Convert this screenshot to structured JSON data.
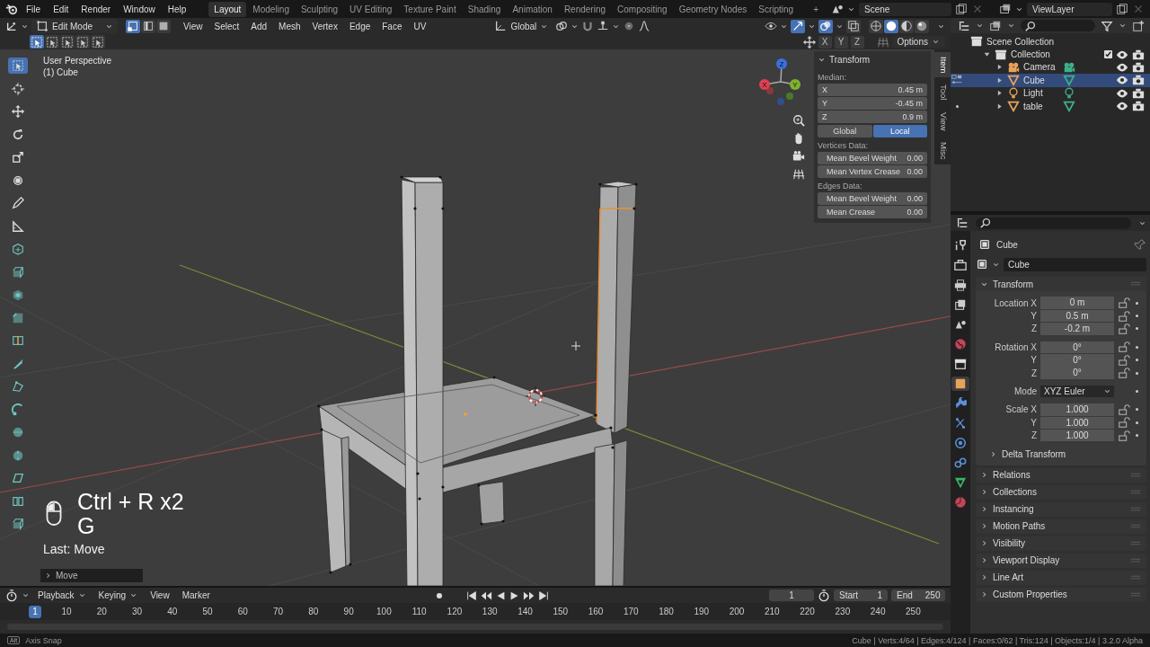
{
  "topbar": {
    "menus": [
      "File",
      "Edit",
      "Render",
      "Window",
      "Help"
    ],
    "workspaces": [
      {
        "label": "Layout",
        "selected": true
      },
      {
        "label": "Modeling",
        "selected": false
      },
      {
        "label": "Sculpting",
        "selected": false
      },
      {
        "label": "UV Editing",
        "selected": false
      },
      {
        "label": "Texture Paint",
        "selected": false
      },
      {
        "label": "Shading",
        "selected": false
      },
      {
        "label": "Animation",
        "selected": false
      },
      {
        "label": "Rendering",
        "selected": false
      },
      {
        "label": "Compositing",
        "selected": false
      },
      {
        "label": "Geometry Nodes",
        "selected": false
      },
      {
        "label": "Scripting",
        "selected": false
      }
    ],
    "add_tab": "+",
    "scene": "Scene",
    "view_layer": "ViewLayer"
  },
  "viewport_header": {
    "mode": "Edit Mode",
    "select_modes": [
      {
        "kind": "vertex",
        "selected": true
      },
      {
        "kind": "edge",
        "selected": false
      },
      {
        "kind": "face",
        "selected": false
      }
    ],
    "menus": [
      "View",
      "Select",
      "Add",
      "Mesh",
      "Vertex",
      "Edge",
      "Face",
      "UV"
    ],
    "orientation": "Global",
    "shading": [
      {
        "kind": "wireframe",
        "selected": false
      },
      {
        "kind": "solid",
        "selected": true
      },
      {
        "kind": "material",
        "selected": false
      },
      {
        "kind": "rendered",
        "selected": false
      }
    ],
    "mirror_axes": [
      "X",
      "Y",
      "Z"
    ],
    "options": "Options"
  },
  "viewport": {
    "view_name": "User Perspective",
    "object_label": "(1) Cube",
    "keystrokes": [
      "Ctrl + R x2",
      "G"
    ],
    "last_operation": "Last: Move",
    "operator_panel": "Move",
    "gizmo_axes": [
      "X",
      "Y",
      "Z"
    ],
    "tools": [
      {
        "kind": "select",
        "selected": true
      },
      {
        "kind": "cursor",
        "selected": false
      },
      {
        "kind": "move",
        "selected": false
      },
      {
        "kind": "rotate",
        "selected": false
      },
      {
        "kind": "scale",
        "selected": false
      },
      {
        "kind": "transform",
        "selected": false
      },
      {
        "kind": "annotate",
        "selected": false
      },
      {
        "kind": "measure",
        "selected": false
      },
      {
        "kind": "add",
        "selected": false
      },
      {
        "kind": "extrude",
        "selected": false
      },
      {
        "kind": "inset",
        "selected": false
      },
      {
        "kind": "bevel",
        "selected": false
      },
      {
        "kind": "loopcut",
        "selected": false
      },
      {
        "kind": "knife",
        "selected": false
      },
      {
        "kind": "polybuild",
        "selected": false
      },
      {
        "kind": "spin",
        "selected": false
      },
      {
        "kind": "smooth",
        "selected": false
      },
      {
        "kind": "shrink",
        "selected": false
      },
      {
        "kind": "shear",
        "selected": false
      },
      {
        "kind": "rip",
        "selected": false
      },
      {
        "kind": "extrude",
        "selected": false
      }
    ]
  },
  "sidebar": {
    "tabs": [
      {
        "label": "Item",
        "selected": true
      },
      {
        "label": "Tool",
        "selected": false
      },
      {
        "label": "View",
        "selected": false
      },
      {
        "label": "Misc",
        "selected": false
      }
    ],
    "panel_title": "Transform",
    "median_label": "Median:",
    "median": [
      {
        "axis": "X",
        "value": "0.45 m"
      },
      {
        "axis": "Y",
        "value": "-0.45 m"
      },
      {
        "axis": "Z",
        "value": "0.9 m"
      }
    ],
    "spaces": [
      {
        "label": "Global",
        "selected": false
      },
      {
        "label": "Local",
        "selected": true
      }
    ],
    "groups": [
      {
        "title": "Vertices Data:",
        "fields": [
          {
            "label": "Mean Bevel Weight",
            "value": "0.00"
          },
          {
            "label": "Mean Vertex Crease",
            "value": "0.00"
          }
        ]
      },
      {
        "title": "Edges Data:",
        "fields": [
          {
            "label": "Mean Bevel Weight",
            "value": "0.00"
          },
          {
            "label": "Mean Crease",
            "value": "0.00"
          }
        ]
      }
    ]
  },
  "outliner": {
    "tree": [
      {
        "name": "Scene Collection",
        "kind": "scene",
        "selected": false,
        "children": [
          {
            "name": "Collection",
            "kind": "collection",
            "selected": false,
            "expanded": true,
            "checked": true,
            "children": [
              {
                "name": "Camera",
                "kind": "camera",
                "selected": false,
                "expanded": false
              },
              {
                "name": "Cube",
                "kind": "mesh",
                "selected": true,
                "expanded": false,
                "edit_mode": true
              },
              {
                "name": "Light",
                "kind": "light",
                "selected": false,
                "expanded": false
              },
              {
                "name": "table",
                "kind": "mesh",
                "selected": false,
                "expanded": false,
                "edit_mode": false
              }
            ]
          }
        ]
      }
    ]
  },
  "properties": {
    "tabs": [
      {
        "kind": "tool",
        "selected": false
      },
      {
        "kind": "render",
        "selected": false
      },
      {
        "kind": "output",
        "selected": false
      },
      {
        "kind": "view_layer",
        "selected": false
      },
      {
        "kind": "scene",
        "selected": false
      },
      {
        "kind": "world",
        "selected": false
      },
      {
        "kind": "collection",
        "selected": false
      },
      {
        "kind": "object",
        "selected": true
      },
      {
        "kind": "modifiers",
        "selected": false
      },
      {
        "kind": "particles",
        "selected": false
      },
      {
        "kind": "physics",
        "selected": false
      },
      {
        "kind": "constraints",
        "selected": false
      },
      {
        "kind": "data",
        "selected": false
      },
      {
        "kind": "material",
        "selected": false
      }
    ],
    "context_name": "Cube",
    "object_name": "Cube",
    "transform": {
      "title": "Transform",
      "expanded": true,
      "groups": [
        {
          "rows": [
            {
              "label": "Location X",
              "value": "0 m",
              "kind": "number"
            },
            {
              "label": "Y",
              "value": "0.5 m",
              "kind": "number"
            },
            {
              "label": "Z",
              "value": "-0.2 m",
              "kind": "number"
            }
          ]
        },
        {
          "rows": [
            {
              "label": "Rotation X",
              "value": "0°",
              "kind": "number"
            },
            {
              "label": "Y",
              "value": "0°",
              "kind": "number"
            },
            {
              "label": "Z",
              "value": "0°",
              "kind": "number"
            }
          ]
        },
        {
          "rows": [
            {
              "label": "Mode",
              "value": "XYZ Euler",
              "kind": "dropdown"
            }
          ]
        },
        {
          "rows": [
            {
              "label": "Scale X",
              "value": "1.000",
              "kind": "number"
            },
            {
              "label": "Y",
              "value": "1.000",
              "kind": "number"
            },
            {
              "label": "Z",
              "value": "1.000",
              "kind": "number"
            }
          ]
        }
      ],
      "subpanel": {
        "title": "Delta Transform",
        "expanded": false
      }
    },
    "panels": [
      {
        "title": "Relations",
        "expanded": false
      },
      {
        "title": "Collections",
        "expanded": false
      },
      {
        "title": "Instancing",
        "expanded": false
      },
      {
        "title": "Motion Paths",
        "expanded": false
      },
      {
        "title": "Visibility",
        "expanded": false
      },
      {
        "title": "Viewport Display",
        "expanded": false
      },
      {
        "title": "Line Art",
        "expanded": false
      },
      {
        "title": "Custom Properties",
        "expanded": false
      }
    ]
  },
  "timeline": {
    "menus": [
      "Playback",
      "Keying",
      "View",
      "Marker"
    ],
    "current_frame": "1",
    "start_label": "Start",
    "start": "1",
    "end_label": "End",
    "end": "250",
    "playhead": "1",
    "ticks": [
      "10",
      "20",
      "30",
      "40",
      "50",
      "60",
      "70",
      "80",
      "90",
      "100",
      "110",
      "120",
      "130",
      "140",
      "150",
      "160",
      "170",
      "180",
      "190",
      "200",
      "210",
      "220",
      "230",
      "240",
      "250"
    ]
  },
  "status_bar": {
    "key": "Alt",
    "hint": "Axis Snap",
    "stats": "Cube | Verts:4/64 | Edges:4/124 | Faces:0/62 | Tris:124 | Objects:1/4 | 3.2.0 Alpha"
  }
}
